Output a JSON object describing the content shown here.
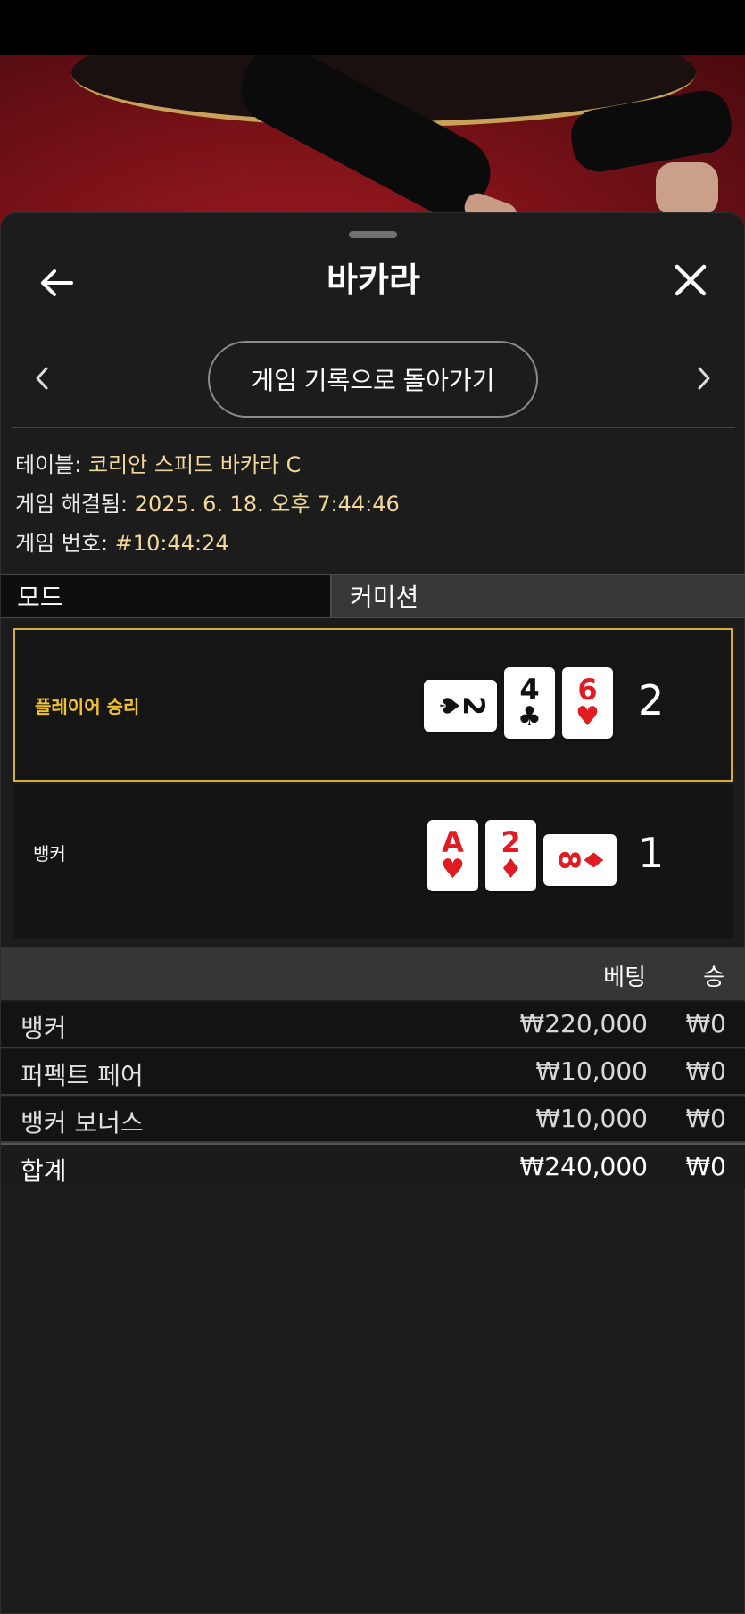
{
  "header": {
    "title": "바카라",
    "back_history_label": "게임 기록으로 돌아가기"
  },
  "game_info": {
    "table_label": "테이블:",
    "table_value": "코리안 스피드 바카라 C",
    "resolved_label": "게임 해결됨:",
    "resolved_value": "2025. 6. 18. 오후 7:44:46",
    "number_label": "게임 번호:",
    "number_value": "#10:44:24"
  },
  "mode": {
    "label": "모드",
    "value": "커미션"
  },
  "hands": {
    "player": {
      "label": "플레이어 승리",
      "score": "2",
      "winner": true,
      "cards": [
        {
          "rank": "2",
          "suit": "♠",
          "color": "#111111",
          "orientation": "horizontal"
        },
        {
          "rank": "4",
          "suit": "♣",
          "color": "#111111",
          "orientation": "vertical"
        },
        {
          "rank": "6",
          "suit": "♥",
          "color": "#e11b22",
          "orientation": "vertical"
        }
      ]
    },
    "banker": {
      "label": "뱅커",
      "score": "1",
      "winner": false,
      "cards": [
        {
          "rank": "A",
          "suit": "♥",
          "color": "#e11b22",
          "orientation": "vertical"
        },
        {
          "rank": "2",
          "suit": "♦",
          "color": "#e11b22",
          "orientation": "vertical"
        },
        {
          "rank": "8",
          "suit": "♦",
          "color": "#e11b22",
          "orientation": "horizontal"
        }
      ]
    }
  },
  "bets_table": {
    "headers": {
      "bet": "베팅",
      "win": "승"
    },
    "rows": [
      {
        "name": "뱅커",
        "bet": "₩220,000",
        "win": "₩0"
      },
      {
        "name": "퍼펙트 페어",
        "bet": "₩10,000",
        "win": "₩0"
      },
      {
        "name": "뱅커 보너스",
        "bet": "₩10,000",
        "win": "₩0"
      }
    ],
    "total": {
      "name": "합계",
      "bet": "₩240,000",
      "win": "₩0"
    }
  },
  "icons": {
    "back": "arrow-left-icon",
    "close": "close-icon",
    "prev": "chevron-left-icon",
    "next": "chevron-right-icon"
  },
  "colors": {
    "accent_gold": "#d4af37",
    "winner_text": "#f2c12e",
    "info_value": "#f1d79a",
    "card_red": "#e11b22"
  }
}
